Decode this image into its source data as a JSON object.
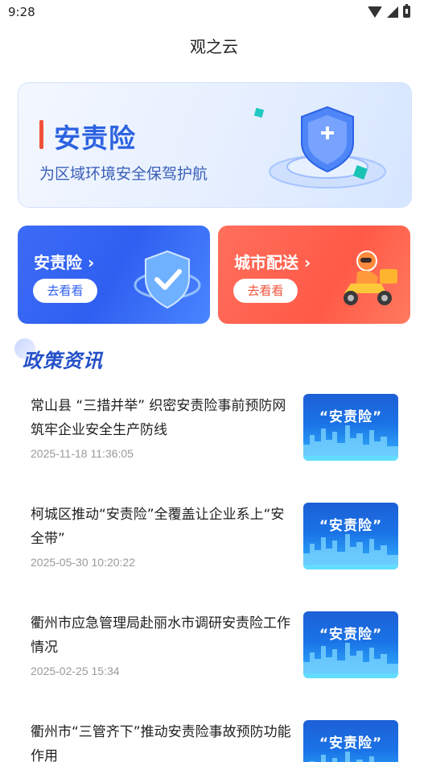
{
  "status_bar": {
    "time": "9:28"
  },
  "header": {
    "title": "观之云"
  },
  "hero": {
    "title": "安责险",
    "subtitle": "为区域环境安全保驾护航"
  },
  "cards": [
    {
      "title": "安责险 ›",
      "button": "去看看"
    },
    {
      "title": "城市配送 ›",
      "button": "去看看"
    }
  ],
  "section": {
    "title": "政策资讯"
  },
  "news": [
    {
      "title": "常山县 “三措并举” 织密安责险事前预防网筑牢企业安全生产防线",
      "date": "2025-11-18 11:36:05",
      "thumb_label": "“安责险”"
    },
    {
      "title": "柯城区推动“安责险”全覆盖让企业系上“安全带”",
      "date": "2025-05-30 10:20:22",
      "thumb_label": "“安责险”"
    },
    {
      "title": "衢州市应急管理局赴丽水市调研安责险工作情况",
      "date": "2025-02-25 15:34",
      "thumb_label": "“安责险”"
    },
    {
      "title": "衢州市“三管齐下”推动安责险事故预防功能作用",
      "date": "",
      "thumb_label": "“安责险”"
    }
  ],
  "colors": {
    "accent_blue": "#2f5ff0",
    "accent_red": "#f1523a",
    "section_title": "#2450c9"
  },
  "icons": [
    "wifi-icon",
    "signal-icon",
    "battery-icon",
    "shield-icon",
    "delivery-scooter-icon"
  ]
}
